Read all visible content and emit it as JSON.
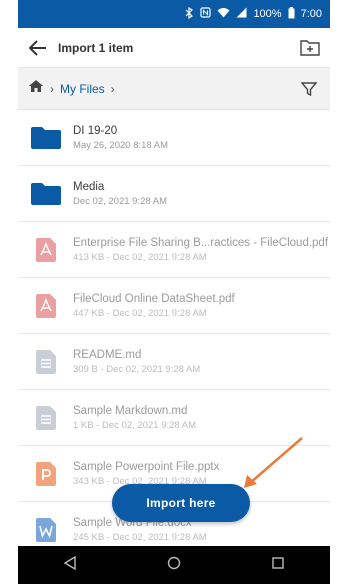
{
  "statusbar": {
    "battery": "100%",
    "time": "7:00",
    "icons": [
      "bluetooth-icon",
      "nfc-icon",
      "wifi-icon",
      "signal-icon",
      "battery-icon"
    ]
  },
  "appbar": {
    "title": "Import 1 item",
    "back_icon": "arrow-left-icon",
    "action_icon": "new-folder-icon"
  },
  "breadcrumb": {
    "home_icon": "home-icon",
    "current": "My Files",
    "filter_icon": "filter-icon"
  },
  "files": [
    {
      "name": "DI 19-20",
      "meta": "May 26, 2020 8:18 AM",
      "type": "folder",
      "disabled": false
    },
    {
      "name": "Media",
      "meta": "Dec 02, 2021 9:28 AM",
      "type": "folder",
      "disabled": false
    },
    {
      "name": "Enterprise File Sharing B...ractices - FileCloud.pdf",
      "meta": "413 KB - Dec 02, 2021 9:28 AM",
      "type": "pdf",
      "disabled": true
    },
    {
      "name": "FileCloud Online DataSheet.pdf",
      "meta": "447 KB - Dec 02, 2021 9:28 AM",
      "type": "pdf",
      "disabled": true
    },
    {
      "name": "README.md",
      "meta": "309 B - Dec 02, 2021 9:28 AM",
      "type": "doc",
      "disabled": true
    },
    {
      "name": "Sample Markdown.md",
      "meta": "1 KB - Dec 02, 2021 9:28 AM",
      "type": "doc",
      "disabled": true
    },
    {
      "name": "Sample Powerpoint File.pptx",
      "meta": "343 KB - Dec 02, 2021 9:28 AM",
      "type": "ppt",
      "disabled": true
    },
    {
      "name": "Sample Word File.docx",
      "meta": "245 KB - Dec 02, 2021 9:28 AM",
      "type": "word",
      "disabled": true
    }
  ],
  "import_button": "Import here",
  "colors": {
    "primary": "#0b5aa6",
    "folder": "#0b5aa6",
    "pdf": "#e57373",
    "doc": "#b0b7c3",
    "ppt": "#f0a07a",
    "word": "#6d9fd6",
    "arrow": "#e87b3c"
  },
  "navbar": {
    "back": "nav-back-icon",
    "home": "nav-home-icon",
    "recents": "nav-recents-icon"
  }
}
